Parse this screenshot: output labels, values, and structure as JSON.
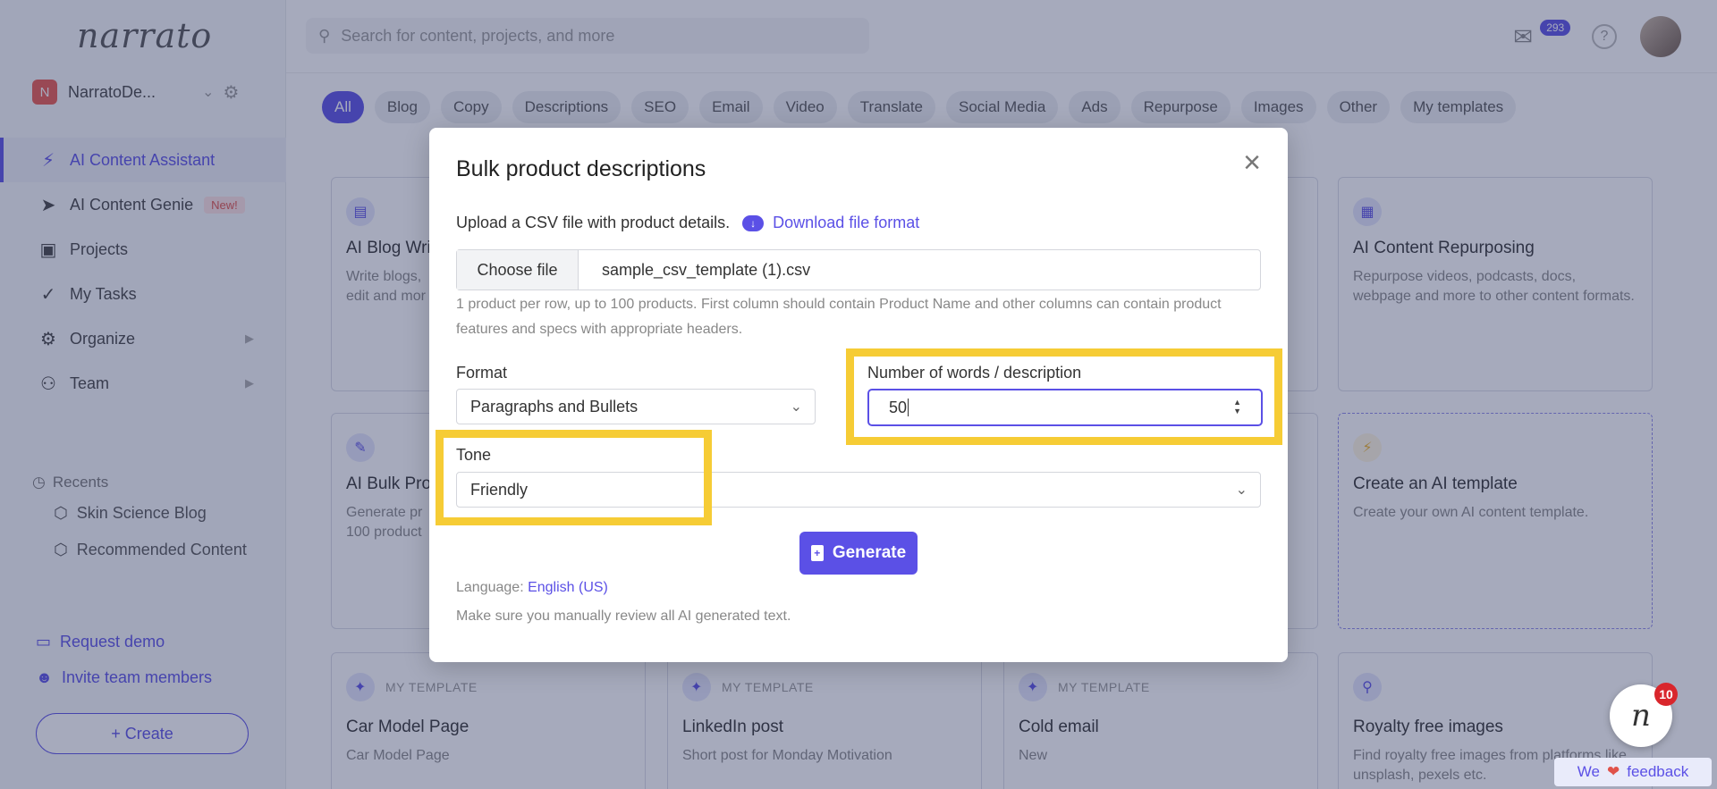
{
  "app": {
    "logo": "narrato",
    "workspace": {
      "initial": "N",
      "name": "NarratoDe..."
    },
    "search_placeholder": "Search for content, projects, and more",
    "mail_count": "293",
    "help": "?"
  },
  "sidebar": {
    "items": [
      {
        "label": "AI Content Assistant"
      },
      {
        "label": "AI Content Genie",
        "badge": "New!"
      },
      {
        "label": "Projects"
      },
      {
        "label": "My Tasks"
      },
      {
        "label": "Organize"
      },
      {
        "label": "Team"
      }
    ],
    "recents_title": "Recents",
    "recents": [
      "Skin Science Blog",
      "Recommended Content"
    ],
    "request_demo": "Request demo",
    "invite": "Invite team members",
    "create": "+ Create"
  },
  "filters": [
    "All",
    "Blog",
    "Copy",
    "Descriptions",
    "SEO",
    "Email",
    "Video",
    "Translate",
    "Social Media",
    "Ads",
    "Repurpose",
    "Images",
    "Other",
    "My templates"
  ],
  "cards": {
    "blog_title": "AI Blog Writ",
    "blog_desc1": "Write blogs, ",
    "blog_desc2": "edit and mor",
    "repurpose_title": "AI Content Repurposing",
    "repurpose_desc": "Repurpose videos, podcasts, docs, webpage and more to other content formats.",
    "bulk_title": "AI Bulk Proc",
    "bulk_desc1": "Generate pr",
    "bulk_desc2": "100 product",
    "template_title": "Create an AI template",
    "template_desc": "Create your own AI content template.",
    "mt_label": "MY TEMPLATE",
    "car_title": "Car Model Page",
    "car_desc": "Car Model Page",
    "linkedin_title": "LinkedIn post",
    "linkedin_desc": "Short post for Monday Motivation",
    "cold_title": "Cold email",
    "cold_desc": "New",
    "royalty_title": "Royalty free images",
    "royalty_desc": "Find royalty free images from platforms like unsplash, pexels etc."
  },
  "modal": {
    "title": "Bulk product descriptions",
    "upload_label": "Upload a CSV file with product details.",
    "download_link": "Download file format",
    "choose_file": "Choose file",
    "file_name": "sample_csv_template (1).csv",
    "help": "1 product per row, up to 100 products. First column should contain Product Name and other columns can contain product features and specs with appropriate headers.",
    "format_label": "Format",
    "format_value": "Paragraphs and Bullets",
    "words_label": "Number of words / description",
    "words_value": "50",
    "tone_label": "Tone",
    "tone_value": "Friendly",
    "generate": "Generate",
    "language_label": "Language: ",
    "language_value": "English (US)",
    "note": "Make sure you manually review all AI generated text."
  },
  "widget": {
    "badge": "10",
    "fab_letter": "n",
    "feedback_we": "We",
    "feedback_text": "feedback"
  },
  "colors": {
    "accent": "#5b50e6",
    "highlight": "#f6cc35",
    "overlay": "rgba(44,52,96,0.42)"
  }
}
